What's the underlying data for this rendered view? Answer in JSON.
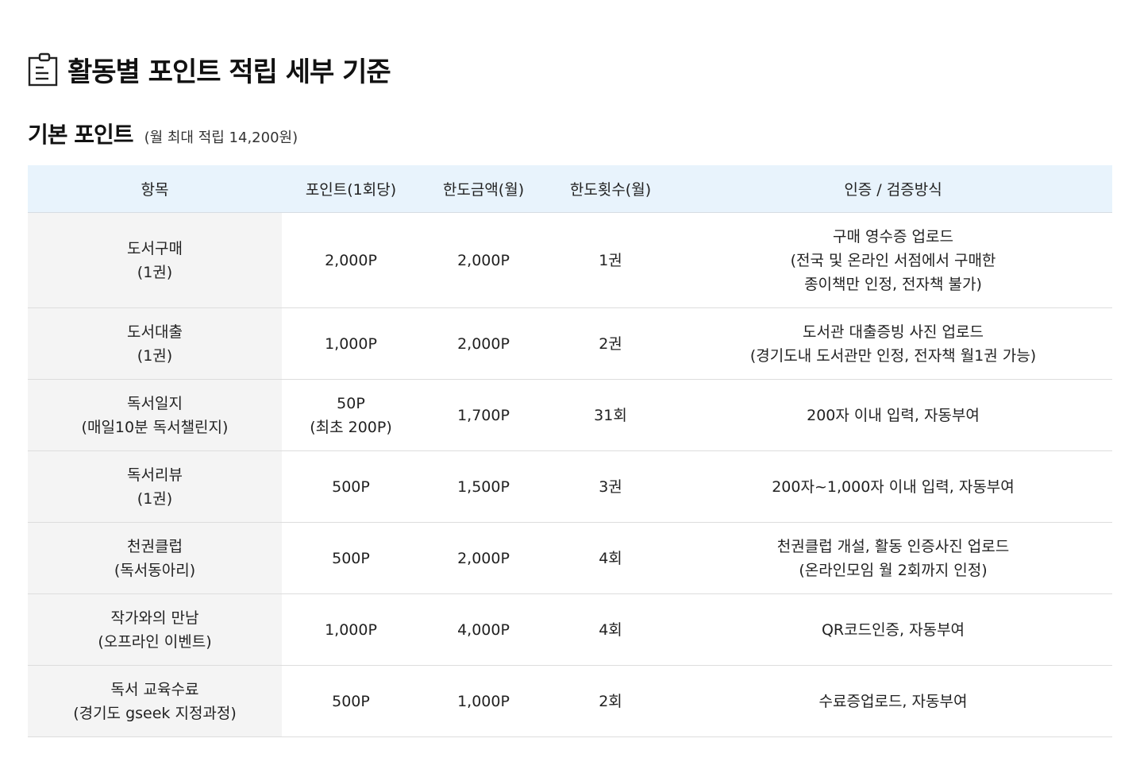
{
  "header": {
    "title": "활동별 포인트 적립 세부 기준",
    "icon": "clipboard-icon"
  },
  "section": {
    "title": "기본 포인트",
    "note": "(월 최대 적립 14,200원)"
  },
  "table": {
    "columns": [
      "항목",
      "포인트(1회당)",
      "한도금액(월)",
      "한도횟수(월)",
      "인증 / 검증방식"
    ],
    "rows": [
      {
        "item": [
          "도서구매",
          "(1권)"
        ],
        "point": [
          "2,000P"
        ],
        "limit_amount": "2,000P",
        "limit_count": "1권",
        "method": [
          "구매 영수증 업로드",
          "(전국 및 온라인 서점에서 구매한",
          "종이책만 인정, 전자책 불가)"
        ]
      },
      {
        "item": [
          "도서대출",
          "(1권)"
        ],
        "point": [
          "1,000P"
        ],
        "limit_amount": "2,000P",
        "limit_count": "2권",
        "method": [
          "도서관 대출증빙 사진 업로드",
          "(경기도내 도서관만 인정, 전자책 월1권 가능)"
        ]
      },
      {
        "item": [
          "독서일지",
          "(매일10분 독서챌린지)"
        ],
        "point": [
          "50P",
          "(최초 200P)"
        ],
        "limit_amount": "1,700P",
        "limit_count": "31회",
        "method": [
          "200자 이내 입력, 자동부여"
        ]
      },
      {
        "item": [
          "독서리뷰",
          "(1권)"
        ],
        "point": [
          "500P"
        ],
        "limit_amount": "1,500P",
        "limit_count": "3권",
        "method": [
          "200자~1,000자 이내 입력, 자동부여"
        ]
      },
      {
        "item": [
          "천권클럽",
          "(독서동아리)"
        ],
        "point": [
          "500P"
        ],
        "limit_amount": "2,000P",
        "limit_count": "4회",
        "method": [
          "천권클럽 개설, 활동 인증사진 업로드",
          "(온라인모임 월 2회까지 인정)"
        ]
      },
      {
        "item": [
          "작가와의 만남",
          "(오프라인 이벤트)"
        ],
        "point": [
          "1,000P"
        ],
        "limit_amount": "4,000P",
        "limit_count": "4회",
        "method": [
          "QR코드인증, 자동부여"
        ]
      },
      {
        "item": [
          "독서 교육수료",
          "(경기도 gseek 지정과정)"
        ],
        "point": [
          "500P"
        ],
        "limit_amount": "1,000P",
        "limit_count": "2회",
        "method": [
          "수료증업로드, 자동부여"
        ]
      }
    ]
  }
}
